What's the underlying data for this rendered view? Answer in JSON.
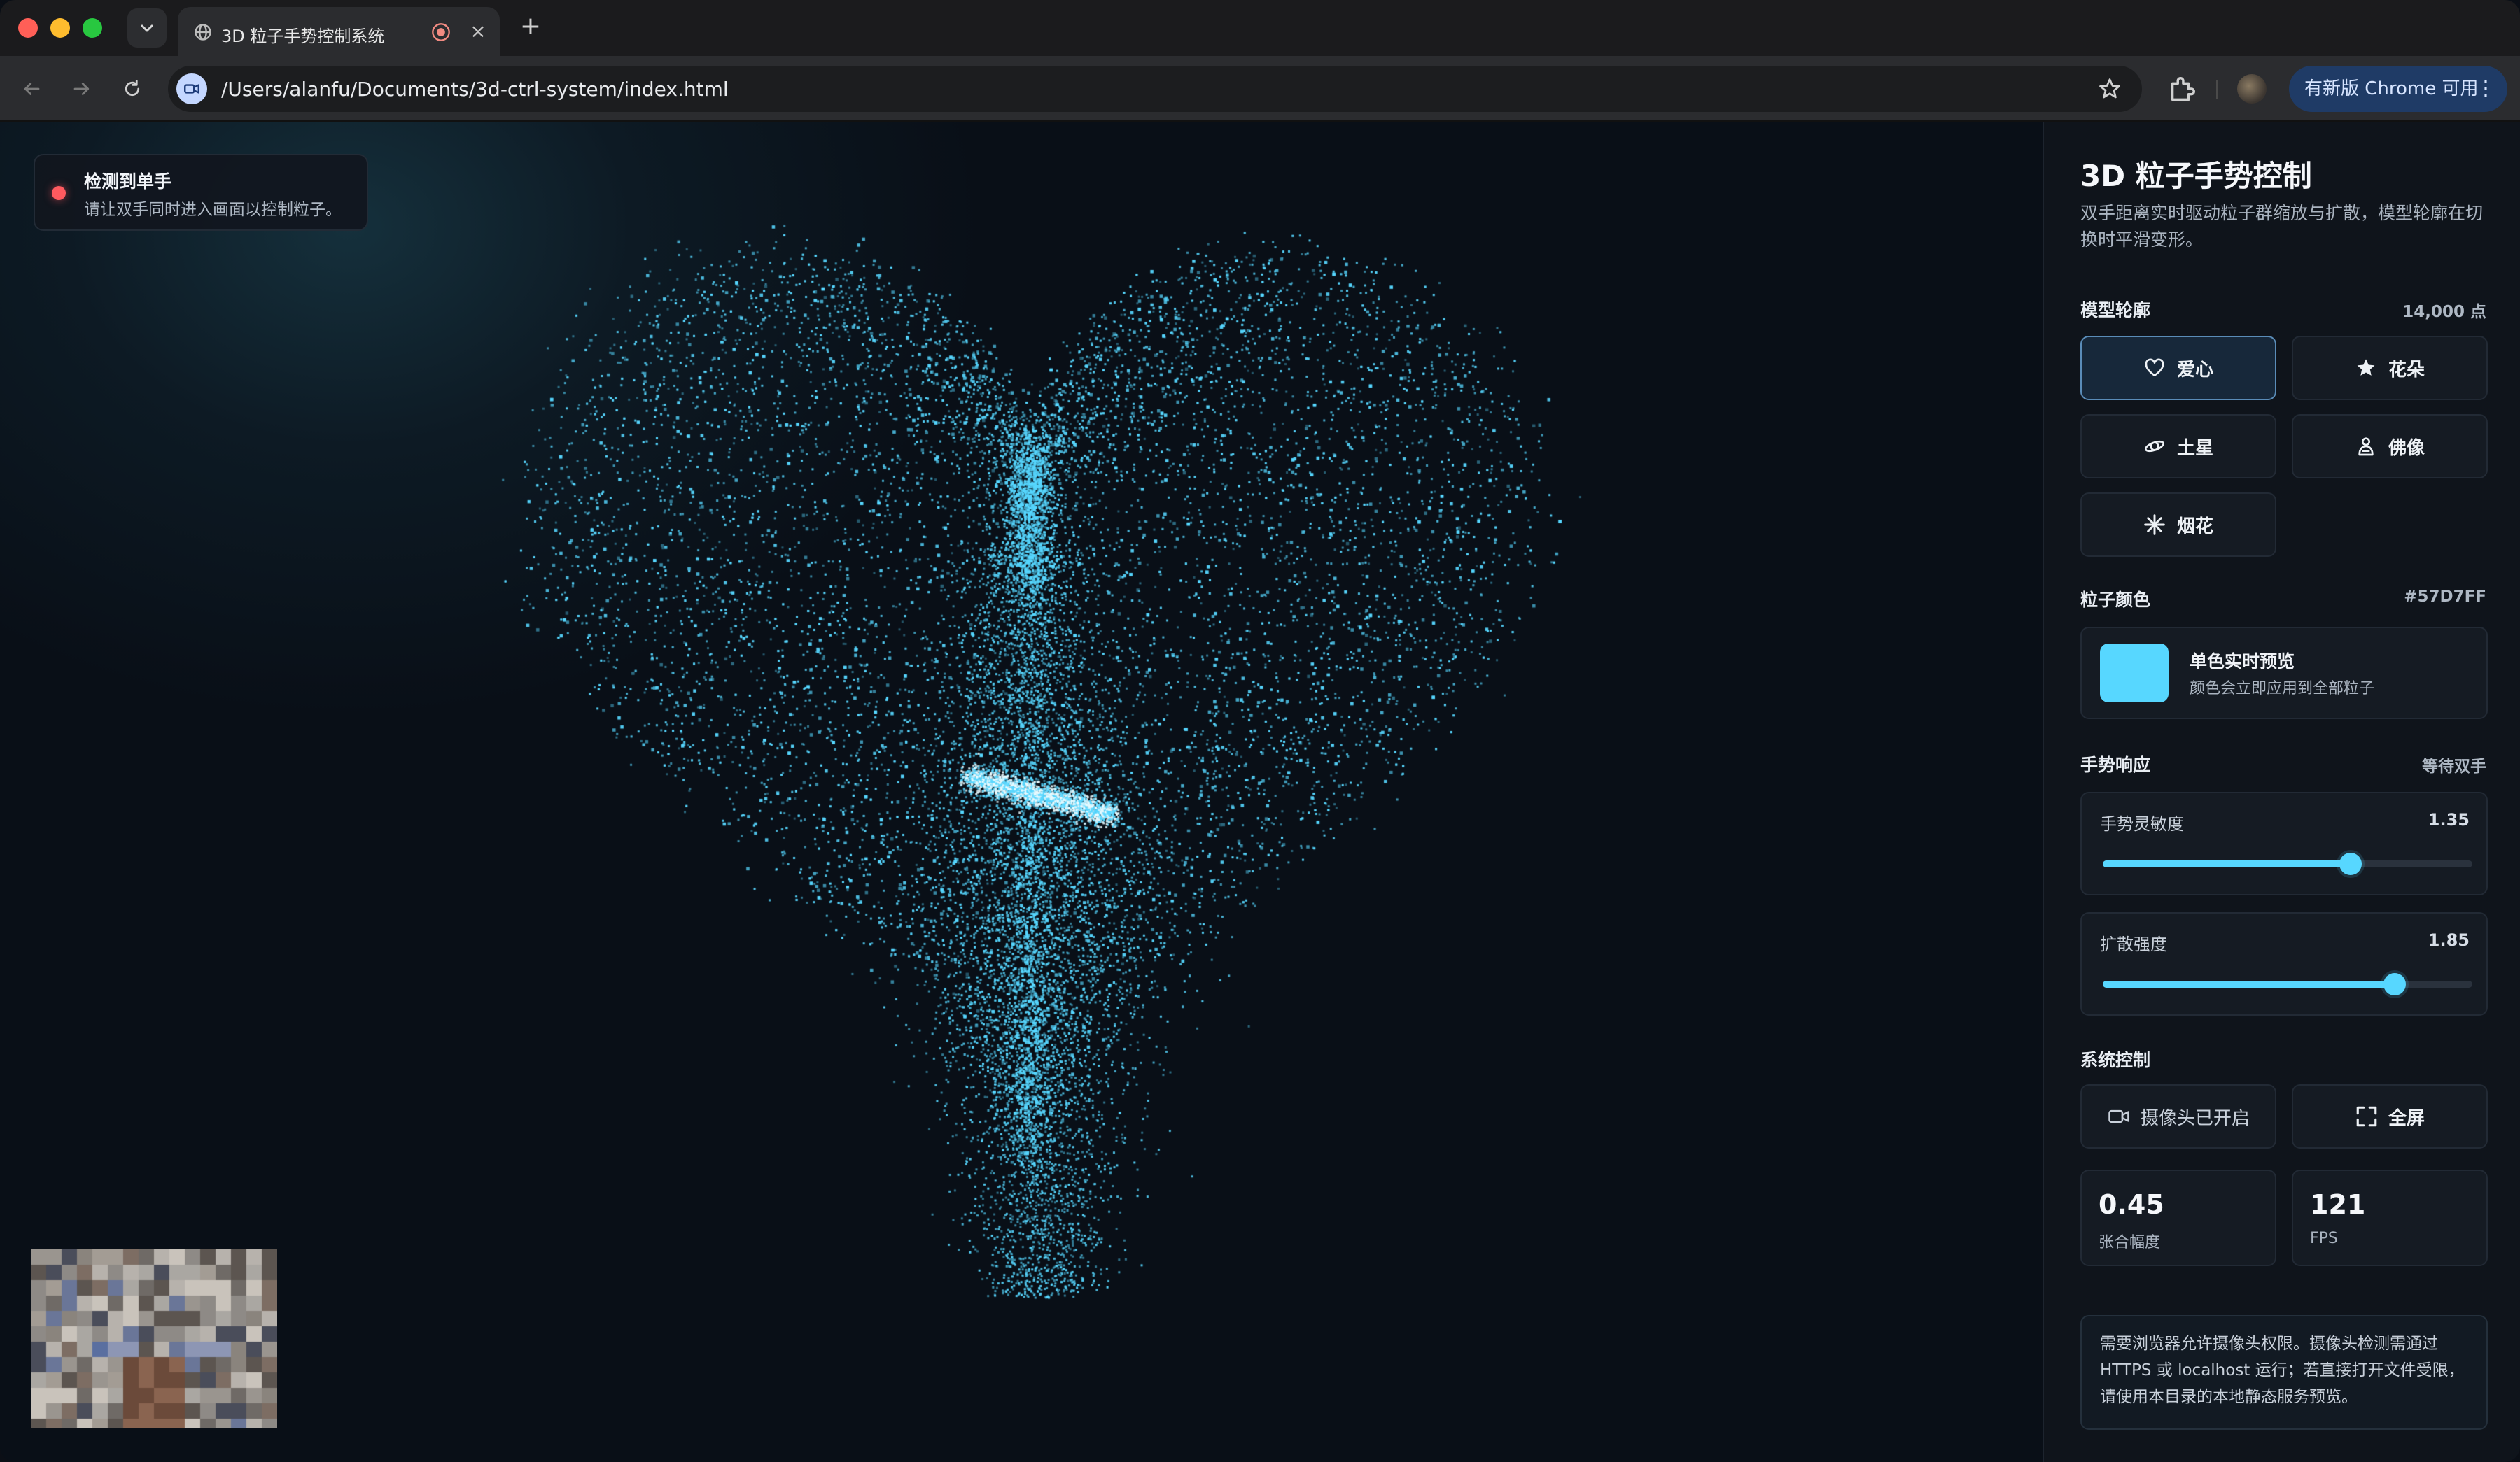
{
  "browser": {
    "tab_title": "3D 粒子手势控制系统",
    "tab_close": "×",
    "new_tab": "+",
    "url": "/Users/alanfu/Documents/3d-ctrl-system/index.html",
    "update_label": "有新版 Chrome 可用",
    "update_more": "⋮"
  },
  "status": {
    "title": "检测到单手",
    "description": "请让双手同时进入画面以控制粒子。",
    "dot_color": "#ff5a5f"
  },
  "panel": {
    "title": "3D 粒子手势控制",
    "description": "双手距离实时驱动粒子群缩放与扩散，模型轮廓在切换时平滑变形。",
    "model": {
      "label": "模型轮廓",
      "count": "14,000 点",
      "shapes": [
        {
          "label": "爱心",
          "icon": "heart-icon",
          "active": true
        },
        {
          "label": "花朵",
          "icon": "flower-icon",
          "active": false
        },
        {
          "label": "土星",
          "icon": "saturn-icon",
          "active": false
        },
        {
          "label": "佛像",
          "icon": "buddha-icon",
          "active": false
        },
        {
          "label": "烟花",
          "icon": "firework-icon",
          "active": false
        }
      ]
    },
    "color": {
      "label": "粒子颜色",
      "hex": "#57D7FF",
      "value": "#57d7ff",
      "title": "单色实时预览",
      "description": "颜色会立即应用到全部粒子"
    },
    "gesture": {
      "label": "手势响应",
      "status": "等待双手",
      "sensitivity": {
        "label": "手势灵敏度",
        "value": "1.35",
        "fraction": 0.67
      },
      "diffusion": {
        "label": "扩散强度",
        "value": "1.85",
        "fraction": 0.79
      }
    },
    "system": {
      "label": "系统控制",
      "camera_button": "摄像头已开启",
      "fullscreen_button": "全屏",
      "stats": [
        {
          "value": "0.45",
          "label": "张合幅度"
        },
        {
          "value": "121",
          "label": "FPS"
        }
      ]
    },
    "note": "需要浏览器允许摄像头权限。摄像头检测需通过 HTTPS 或 localhost 运行；若直接打开文件受限，请使用本目录的本地静态服务预览。"
  }
}
